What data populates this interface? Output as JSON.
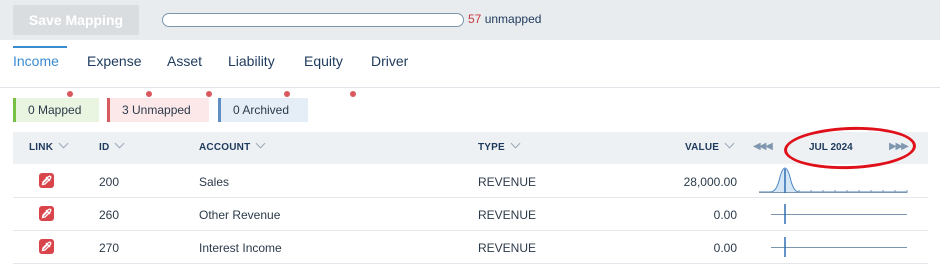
{
  "toolbar": {
    "save_label": "Save Mapping",
    "progress_fraction": 0,
    "unmapped_count": "57",
    "unmapped_label": "unmapped"
  },
  "tabs": [
    {
      "label": "Income",
      "active": true,
      "has_dot": true
    },
    {
      "label": "Expense",
      "active": false,
      "has_dot": true
    },
    {
      "label": "Asset",
      "active": false,
      "has_dot": true
    },
    {
      "label": "Liability",
      "active": false,
      "has_dot": true
    },
    {
      "label": "Equity",
      "active": false,
      "has_dot": true
    },
    {
      "label": "Driver",
      "active": false,
      "has_dot": false
    }
  ],
  "filters": {
    "mapped": "0 Mapped",
    "unmapped": "3 Unmapped",
    "archived": "0 Archived"
  },
  "table": {
    "columns": {
      "link": "LINK",
      "id": "ID",
      "account": "ACCOUNT",
      "type": "TYPE",
      "value": "VALUE"
    },
    "period": "JUL 2024",
    "rows": [
      {
        "id": "200",
        "account": "Sales",
        "type": "REVENUE",
        "value": "28,000.00"
      },
      {
        "id": "260",
        "account": "Other Revenue",
        "type": "REVENUE",
        "value": "0.00"
      },
      {
        "id": "270",
        "account": "Interest Income",
        "type": "REVENUE",
        "value": "0.00"
      }
    ]
  },
  "colors": {
    "accent": "#3b8bd0",
    "alert_red": "#d9444a",
    "mapped_green": "#77c043",
    "annotation_circle": "#e0101a"
  },
  "icons": {
    "link": "edit-link-icon",
    "prev_period": "rewind-icon",
    "next_period": "fast-forward-icon"
  }
}
